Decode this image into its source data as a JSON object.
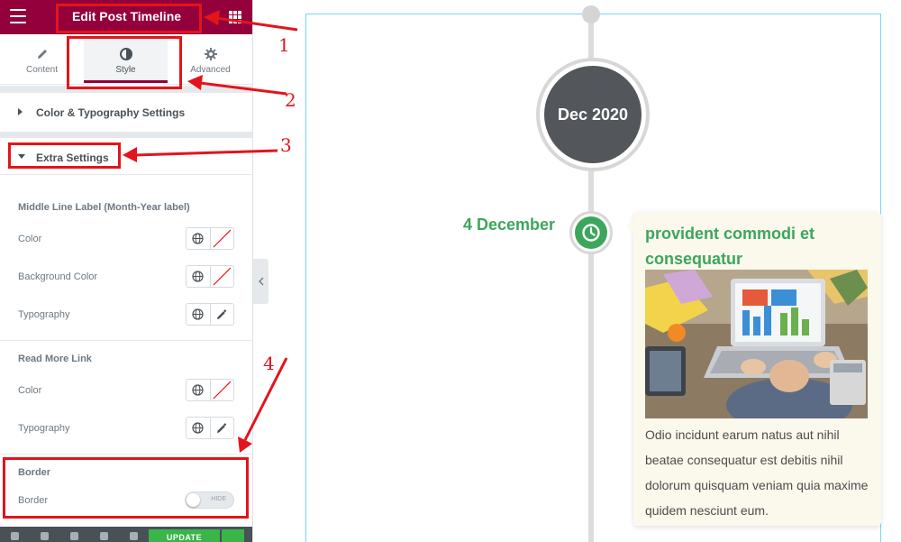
{
  "sidebar": {
    "header_title": "Edit Post Timeline",
    "tabs": [
      {
        "label": "Content",
        "icon": "pencil-icon"
      },
      {
        "label": "Style",
        "icon": "half-circle-icon",
        "active": true
      },
      {
        "label": "Advanced",
        "icon": "gear-icon"
      }
    ],
    "sections": {
      "color_typography": "Color & Typography Settings",
      "extra_settings": "Extra Settings"
    },
    "middle_line_label": {
      "heading": "Middle Line Label (Month-Year label)",
      "color": "Color",
      "background_color": "Background Color",
      "typography": "Typography"
    },
    "read_more": {
      "heading": "Read More Link",
      "color": "Color",
      "typography": "Typography"
    },
    "border": {
      "heading": "Border",
      "label": "Border",
      "toggle_text": "HIDE",
      "enabled": false
    },
    "footer": {
      "update_label": "UPDATE"
    }
  },
  "preview": {
    "month_label": "Dec 2020",
    "date_label": "4 December",
    "post": {
      "title": "provident commodi et consequatur",
      "excerpt": "Odio incidunt earum natus aut nihil beatae consequatur est debitis nihil dolorum quisquam veniam quia maxime quidem nesciunt eum."
    }
  },
  "annotations": [
    "1",
    "2",
    "3",
    "4"
  ],
  "colors": {
    "brand": "#93003c",
    "accent_green": "#3ca65c",
    "annotation_red": "#e3141b"
  }
}
